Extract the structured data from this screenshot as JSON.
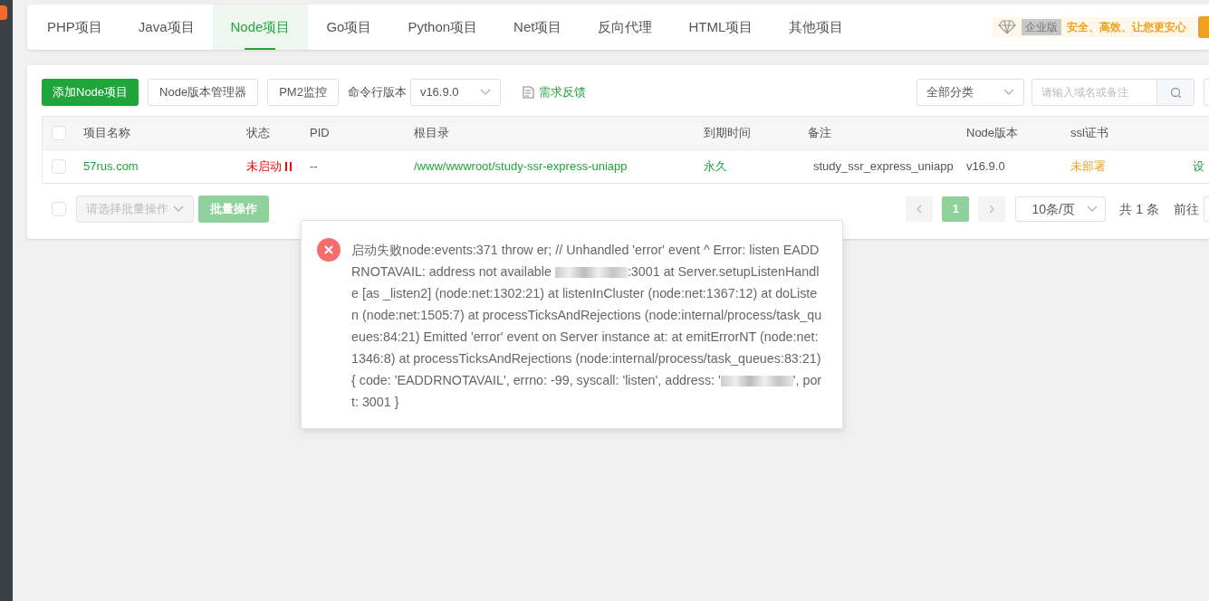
{
  "tabs": [
    {
      "label": "PHP项目",
      "selected": false
    },
    {
      "label": "Java项目",
      "selected": false
    },
    {
      "label": "Node项目",
      "selected": true
    },
    {
      "label": "Go项目",
      "selected": false
    },
    {
      "label": "Python项目",
      "selected": false
    },
    {
      "label": "Net项目",
      "selected": false
    },
    {
      "label": "反向代理",
      "selected": false
    },
    {
      "label": "HTML项目",
      "selected": false
    },
    {
      "label": "其他项目",
      "selected": false
    }
  ],
  "promo": {
    "badge": "企业版",
    "slogan": "安全、高效、让您更安心"
  },
  "toolbar": {
    "add_button": "添加Node项目",
    "version_manager": "Node版本管理器",
    "pm2": "PM2监控",
    "cli_label": "命令行版本",
    "cli_version": "v16.9.0",
    "feedback": "需求反馈",
    "category": "全部分类",
    "search_placeholder": "请输入域名或备注"
  },
  "table": {
    "all_checked": false,
    "columns": [
      "项目名称",
      "状态",
      "PID",
      "根目录",
      "到期时间",
      "备注",
      "Node版本",
      "ssl证书"
    ],
    "rows": [
      {
        "checked": false,
        "name": "57rus.com",
        "status": "未启动",
        "running": false,
        "pid": "--",
        "root": "/www/wwwroot/study-ssr-express-uniapp",
        "expiry": "永久",
        "note": "study_ssr_express_uniapp",
        "node_version": "v16.9.0",
        "ssl": "未部署",
        "action": "设"
      }
    ]
  },
  "footer": {
    "select_all_checked": false,
    "batch_placeholder": "请选择批量操作",
    "batch_button": "批量操作",
    "pages": [
      {
        "label": "1",
        "selected": true
      }
    ],
    "page_size": "10条/页",
    "total": "共 1 条",
    "goto": "前往"
  },
  "message": {
    "segments": [
      {
        "kind": "text",
        "text": "启动失败node:events:371 throw er; // Unhandled 'error' event ^ Error: listen EADDRNOTAVAIL: address not available "
      },
      {
        "kind": "redacted"
      },
      {
        "kind": "text",
        "text": ":3001 at Server.setupListenHandle [as _listen2] (node:net:1302:21) at listenInCluster (node:net:1367:12) at doListen (node:net:1505:7) at processTicksAndRejections (node:internal/process/task_queues:84:21) Emitted 'error' event on Server instance at: at emitErrorNT (node:net:1346:8) at processTicksAndRejections (node:internal/process/task_queues:83:21) { code: 'EADDRNOTAVAIL', errno: -99, syscall: 'listen', address: '"
      },
      {
        "kind": "redacted"
      },
      {
        "kind": "text",
        "text": "', port: 3001 }"
      }
    ]
  }
}
